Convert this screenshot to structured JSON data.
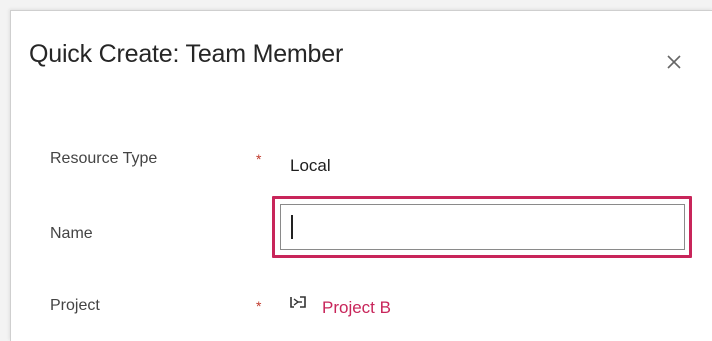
{
  "dialog": {
    "title": "Quick Create: Team Member"
  },
  "fields": {
    "resource_type": {
      "label": "Resource Type",
      "required_mark": "*",
      "value": "Local"
    },
    "name": {
      "label": "Name",
      "value": ""
    },
    "project": {
      "label": "Project",
      "required_mark": "*",
      "value": "Project B"
    }
  },
  "icons": {
    "close": "close-icon",
    "lookup": "project-icon"
  },
  "colors": {
    "accent": "#c8255a",
    "required": "#c0392b"
  }
}
